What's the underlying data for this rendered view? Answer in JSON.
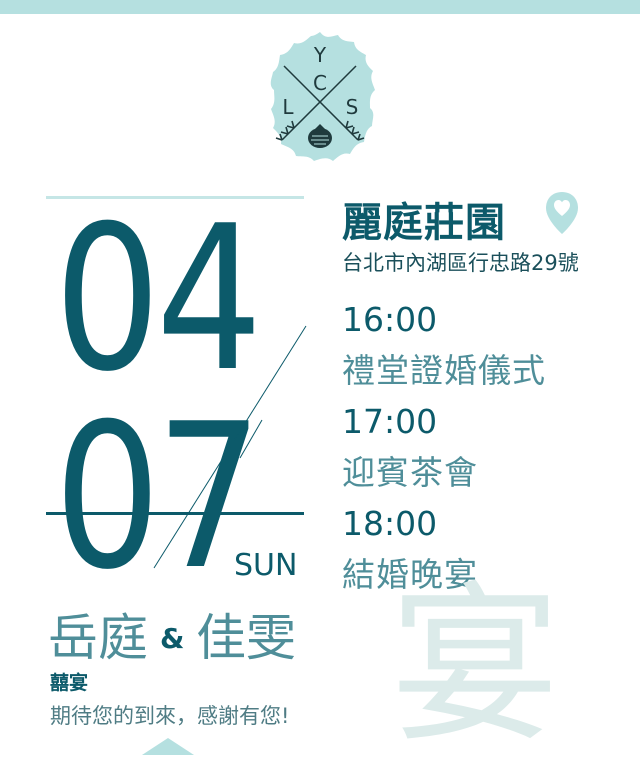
{
  "colors": {
    "accent_dark": "#0c5a6a",
    "accent_mid": "#4f8e99",
    "accent_light": "#b5e0e0",
    "watermark": "#dcebea"
  },
  "logo": {
    "letters": {
      "top": "Y",
      "middle": "C",
      "left": "L",
      "right": "S"
    },
    "icons": [
      "pinecone-icon",
      "arrow-icon"
    ]
  },
  "date": {
    "month": "04",
    "day": "07",
    "weekday": "SUN"
  },
  "venue": {
    "name": "麗庭莊園",
    "address": "台北市內湖區行忠路29號",
    "icon": "heart-location-icon"
  },
  "schedule": [
    {
      "time": "16:00",
      "event": "禮堂證婚儀式"
    },
    {
      "time": "17:00",
      "event": "迎賓茶會"
    },
    {
      "time": "18:00",
      "event": "結婚晚宴"
    }
  ],
  "couple": {
    "groom": "岳庭",
    "ampersand": "&",
    "bride": "佳雯"
  },
  "banquet": {
    "title": "囍宴",
    "message": "期待您的到來，感謝有您!"
  },
  "watermark_char": "宴"
}
